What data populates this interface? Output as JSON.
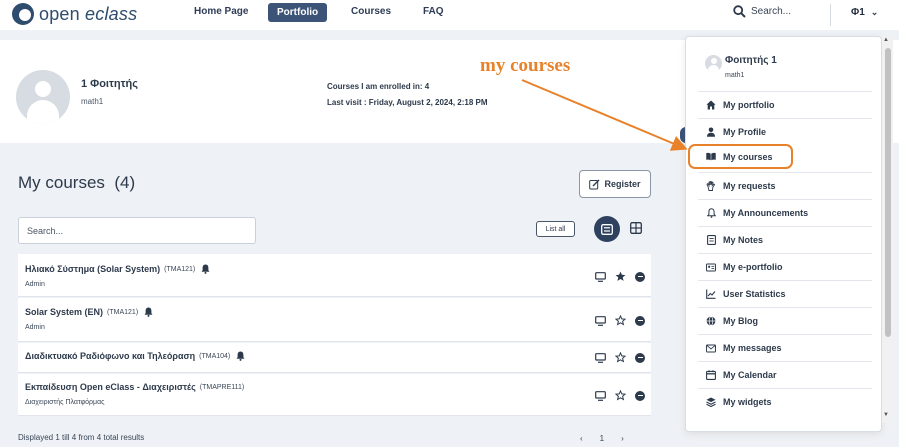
{
  "brand": {
    "logo_text_plain": "open ",
    "logo_text_italic": "eclass"
  },
  "nav": {
    "links": [
      {
        "label": "Home Page"
      },
      {
        "label": "Portfolio"
      },
      {
        "label": "Courses"
      },
      {
        "label": "FAQ"
      }
    ],
    "search_label": "Search...",
    "user_menu_label": "Φ1"
  },
  "profile": {
    "name": "1 Φοιτητής",
    "username": "math1",
    "enrolled_text": "Courses I am enrolled in: 4",
    "last_visit_text": "Last visit : Friday, August 2, 2024, 2:18 PM"
  },
  "my_courses": {
    "title": "My courses",
    "count": "(4)",
    "register_label": "Register",
    "search_placeholder": "Search...",
    "list_all_label": "List all",
    "courses": [
      {
        "title": "Ηλιακό Σύστημα (Solar System)",
        "code": "(TMA121)",
        "subtitle": "Admin",
        "favorite": true
      },
      {
        "title": "Solar System (EN)",
        "code": "(TMA121)",
        "subtitle": "Admin",
        "favorite": false
      },
      {
        "title": "Διαδικτυακό Ραδιόφωνο και Τηλεόραση",
        "code": "(TMA104)",
        "subtitle": "",
        "favorite": false
      },
      {
        "title": "Εκπαίδευση Open eClass - Διαχειριστές",
        "code": "(TMAPRE111)",
        "subtitle": "Διαχειριστής Πλατφόρμας",
        "favorite": false
      }
    ],
    "footer_text": "Displayed 1 till 4 from 4 total results",
    "pager": {
      "prev": "‹",
      "page": "1",
      "next": "›"
    }
  },
  "annotation": {
    "text": "my courses",
    "color": "#e8822a"
  },
  "dropdown": {
    "user_name": "Φοιτητής 1",
    "username": "math1",
    "items": [
      {
        "label": "My portfolio",
        "icon": "home-icon"
      },
      {
        "label": "My Profile",
        "icon": "user-icon"
      },
      {
        "label": "My courses",
        "icon": "book-icon",
        "highlighted": true
      },
      {
        "label": "My requests",
        "icon": "hand-icon"
      },
      {
        "label": "My Announcements",
        "icon": "bell-icon"
      },
      {
        "label": "My Notes",
        "icon": "note-icon"
      },
      {
        "label": "My e-portfolio",
        "icon": "id-card-icon"
      },
      {
        "label": "User Statistics",
        "icon": "chart-icon"
      },
      {
        "label": "My Blog",
        "icon": "globe-icon"
      },
      {
        "label": "My messages",
        "icon": "envelope-icon"
      },
      {
        "label": "My Calendar",
        "icon": "calendar-icon"
      },
      {
        "label": "My widgets",
        "icon": "layers-icon"
      }
    ]
  },
  "colors": {
    "accent": "#3c5478",
    "nav_text": "#2e3d56",
    "annotation": "#e8822a"
  }
}
